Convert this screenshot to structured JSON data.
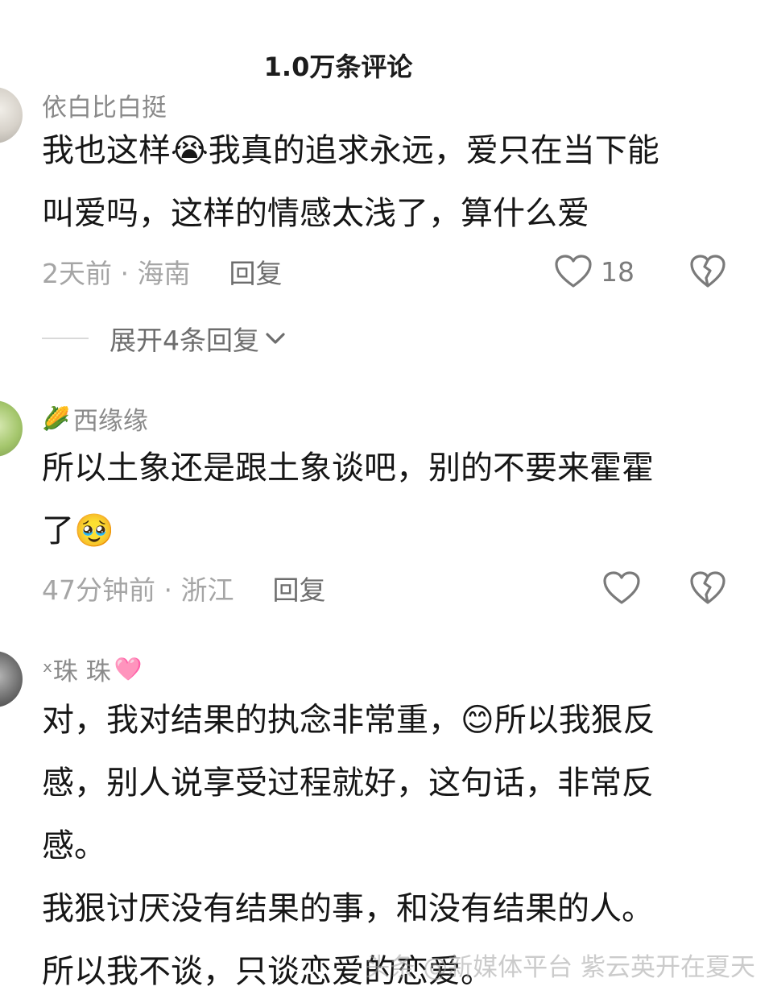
{
  "header": {
    "title": "1.0万条评论"
  },
  "comments": [
    {
      "username": "依白比白挺",
      "username_emoji": "",
      "lines": [
        "我也这样😭我真的追求永远，爱只在当下能",
        "叫爱吗，这样的情感太浅了，算什么爱"
      ],
      "time_location": "2天前 · 海南",
      "reply_label": "回复",
      "like_count": "18",
      "expand_label": "展开4条回复"
    },
    {
      "username": "西缘缘",
      "username_emoji": "🌽",
      "lines": [
        "所以土象还是跟土象谈吧，别的不要来霍霍",
        "了🥹"
      ],
      "time_location": "47分钟前 · 浙江",
      "reply_label": "回复",
      "like_count": ""
    },
    {
      "username": "ˣ珠 珠",
      "username_emoji": "🩷",
      "lines": [
        "对，我对结果的执念非常重，😊所以我狠反",
        "感，别人说享受过程就好，这句话，非常反",
        "感。",
        "我狠讨厌没有结果的事，和没有结果的人。",
        "所以我不谈，只谈恋爱的恋爱。"
      ]
    }
  ],
  "watermark": "头条 @新媒体平台 紫云英开在夏天",
  "icons": {
    "like": "heart-outline-icon",
    "dislike": "broken-heart-icon",
    "expand": "chevron-down-icon"
  },
  "colors": {
    "text": "#161616",
    "meta": "#9b9b9b",
    "username": "#8a8a8a",
    "background": "#ffffff"
  }
}
